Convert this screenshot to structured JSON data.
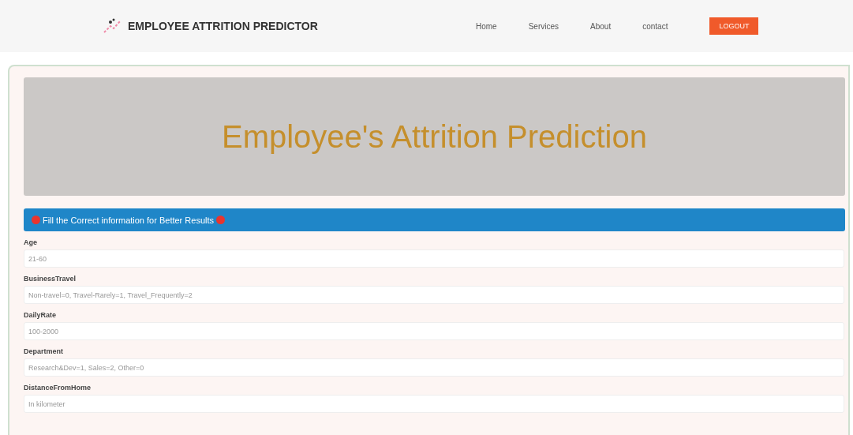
{
  "navbar": {
    "brand": "EMPLOYEE ATTRITION PREDICTOR",
    "links": [
      "Home",
      "Services",
      "About",
      "contact"
    ],
    "logout": "LOGOUT"
  },
  "hero": {
    "title": "Employee's Attrition Prediction"
  },
  "notice": {
    "text": "Fill the Correct information for Better Results"
  },
  "fields": [
    {
      "label": "Age",
      "placeholder": "21-60"
    },
    {
      "label": "BusinessTravel",
      "placeholder": "Non-travel=0, Travel-Rarely=1, Travel_Frequently=2"
    },
    {
      "label": "DailyRate",
      "placeholder": "100-2000"
    },
    {
      "label": "Department",
      "placeholder": "Research&Dev=1, Sales=2, Other=0"
    },
    {
      "label": "DistanceFromHome",
      "placeholder": "In kilometer"
    }
  ]
}
